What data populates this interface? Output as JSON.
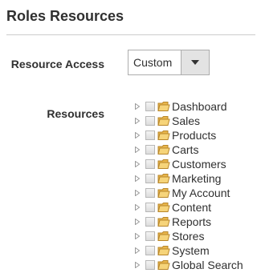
{
  "section": {
    "title": "Roles Resources"
  },
  "resource_access": {
    "label": "Resource Access",
    "selected": "Custom"
  },
  "resources": {
    "label": "Resources",
    "items": [
      {
        "label": "Dashboard"
      },
      {
        "label": "Sales"
      },
      {
        "label": "Products"
      },
      {
        "label": "Carts"
      },
      {
        "label": "Customers"
      },
      {
        "label": "Marketing"
      },
      {
        "label": "My Account"
      },
      {
        "label": "Content"
      },
      {
        "label": "Reports"
      },
      {
        "label": "Stores"
      },
      {
        "label": "System"
      },
      {
        "label": "Global Search"
      }
    ]
  },
  "icons": {
    "dropdown": "triangle-down-icon",
    "expand": "triangle-right-icon",
    "node": "folder-icon"
  },
  "colors": {
    "folder": "#e8b64c",
    "text": "#303030",
    "border": "#adadad"
  }
}
